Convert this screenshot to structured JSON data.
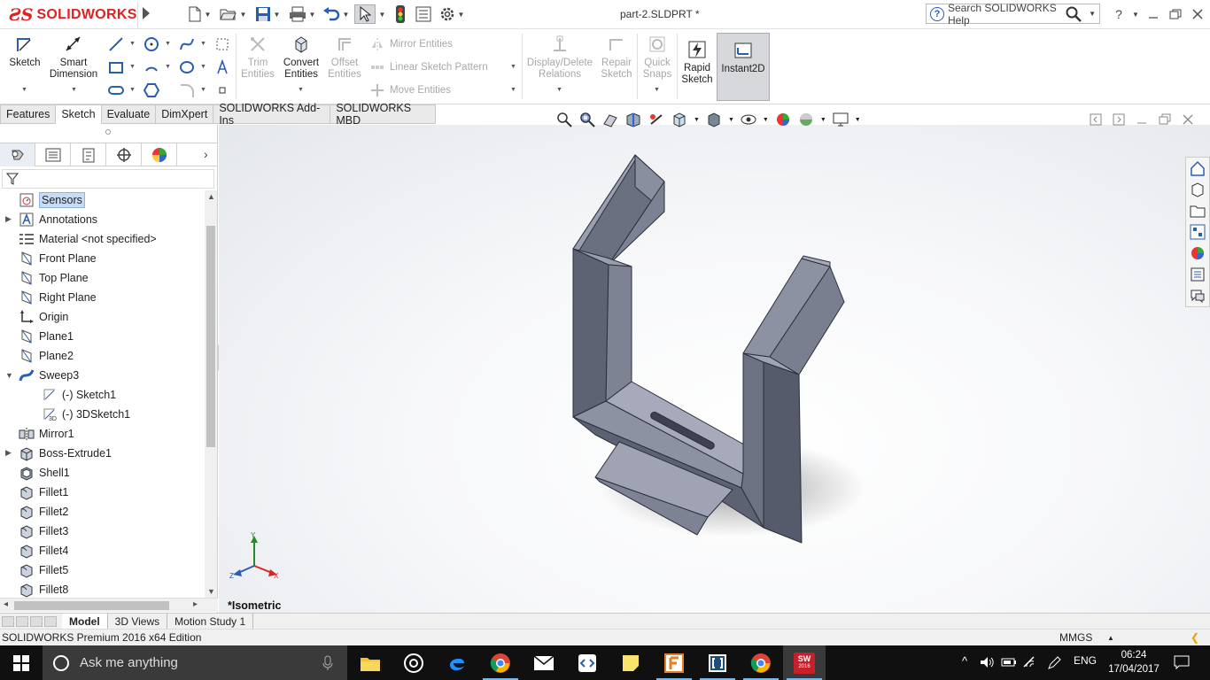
{
  "window": {
    "app_name": "SOLIDWORKS",
    "document_title": "part-2.SLDPRT *",
    "help_placeholder": "Search SOLIDWORKS Help",
    "help_question": "?"
  },
  "command_manager": {
    "sketch": "Sketch",
    "smart_dimension": [
      "Smart",
      "Dimension"
    ],
    "trim_entities": [
      "Trim",
      "Entities"
    ],
    "convert_entities": [
      "Convert",
      "Entities"
    ],
    "offset_entities": [
      "Offset",
      "Entities"
    ],
    "mirror_entities": "Mirror Entities",
    "linear_sketch_pattern": "Linear Sketch Pattern",
    "move_entities": "Move Entities",
    "display_delete_relations": [
      "Display/Delete",
      "Relations"
    ],
    "repair_sketch": [
      "Repair",
      "Sketch"
    ],
    "quick_snaps": [
      "Quick",
      "Snaps"
    ],
    "rapid_sketch": [
      "Rapid",
      "Sketch"
    ],
    "instant2d": "Instant2D"
  },
  "tabs": [
    {
      "label": "Features",
      "active": false
    },
    {
      "label": "Sketch",
      "active": true
    },
    {
      "label": "Evaluate",
      "active": false
    },
    {
      "label": "DimXpert",
      "active": false
    },
    {
      "label": "SOLIDWORKS Add-Ins",
      "active": false
    },
    {
      "label": "SOLIDWORKS MBD",
      "active": false
    }
  ],
  "tree": [
    {
      "label": "Sensors",
      "icon": "sensor-icon",
      "selected": true
    },
    {
      "label": "Annotations",
      "icon": "annotation-icon",
      "expandable": true
    },
    {
      "label": "Material <not specified>",
      "icon": "material-icon"
    },
    {
      "label": "Front Plane",
      "icon": "plane-icon"
    },
    {
      "label": "Top Plane",
      "icon": "plane-icon"
    },
    {
      "label": "Right Plane",
      "icon": "plane-icon"
    },
    {
      "label": "Origin",
      "icon": "origin-icon"
    },
    {
      "label": "Plane1",
      "icon": "plane-icon"
    },
    {
      "label": "Plane2",
      "icon": "plane-icon"
    },
    {
      "label": "Sweep3",
      "icon": "sweep-icon",
      "expanded": true
    },
    {
      "label": "(-) Sketch1",
      "icon": "sketch-icon",
      "child": true
    },
    {
      "label": "(-) 3DSketch1",
      "icon": "3d-sketch-icon",
      "child": true
    },
    {
      "label": "Mirror1",
      "icon": "mirror-icon"
    },
    {
      "label": "Boss-Extrude1",
      "icon": "extrude-icon",
      "expandable": true
    },
    {
      "label": "Shell1",
      "icon": "shell-icon"
    },
    {
      "label": "Fillet1",
      "icon": "fillet-icon"
    },
    {
      "label": "Fillet2",
      "icon": "fillet-icon"
    },
    {
      "label": "Fillet3",
      "icon": "fillet-icon"
    },
    {
      "label": "Fillet4",
      "icon": "fillet-icon"
    },
    {
      "label": "Fillet5",
      "icon": "fillet-icon"
    },
    {
      "label": "Fillet8",
      "icon": "fillet-icon"
    }
  ],
  "viewport": {
    "view_label": "*Isometric",
    "triad": {
      "x": "X",
      "y": "Y",
      "z": "Z"
    }
  },
  "bottom_tabs": [
    {
      "label": "Model",
      "active": true
    },
    {
      "label": "3D Views",
      "active": false
    },
    {
      "label": "Motion Study 1",
      "active": false
    }
  ],
  "status": {
    "edition": "SOLIDWORKS Premium 2016 x64 Edition",
    "units": "MMGS",
    "units_arrow": "▲"
  },
  "taskbar": {
    "search_placeholder": "Ask me anything",
    "language": "ENG",
    "time": "06:24",
    "date": "17/04/2017",
    "sw_badge": "2016"
  },
  "colors": {
    "brand_red": "#d22222",
    "selection": "#c7dcf3",
    "taskbar": "#101010"
  }
}
